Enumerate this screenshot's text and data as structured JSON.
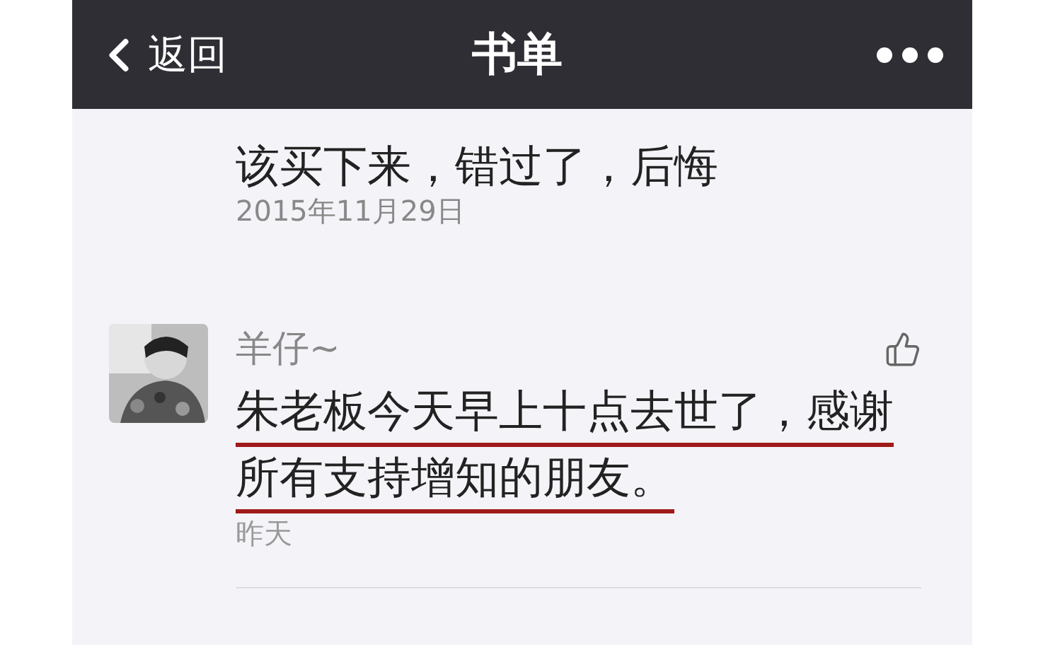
{
  "nav_bar": {
    "back_label": "返回",
    "title": "书单"
  },
  "previous_comment": {
    "text": "该买下来，错过了，后悔",
    "date": "2015年11月29日"
  },
  "comment": {
    "author": "羊仔~",
    "text": "朱老板今天早上十点去世了，感谢所有支持增知的朋友。",
    "underlined": true,
    "time": "昨天",
    "liked": false
  }
}
